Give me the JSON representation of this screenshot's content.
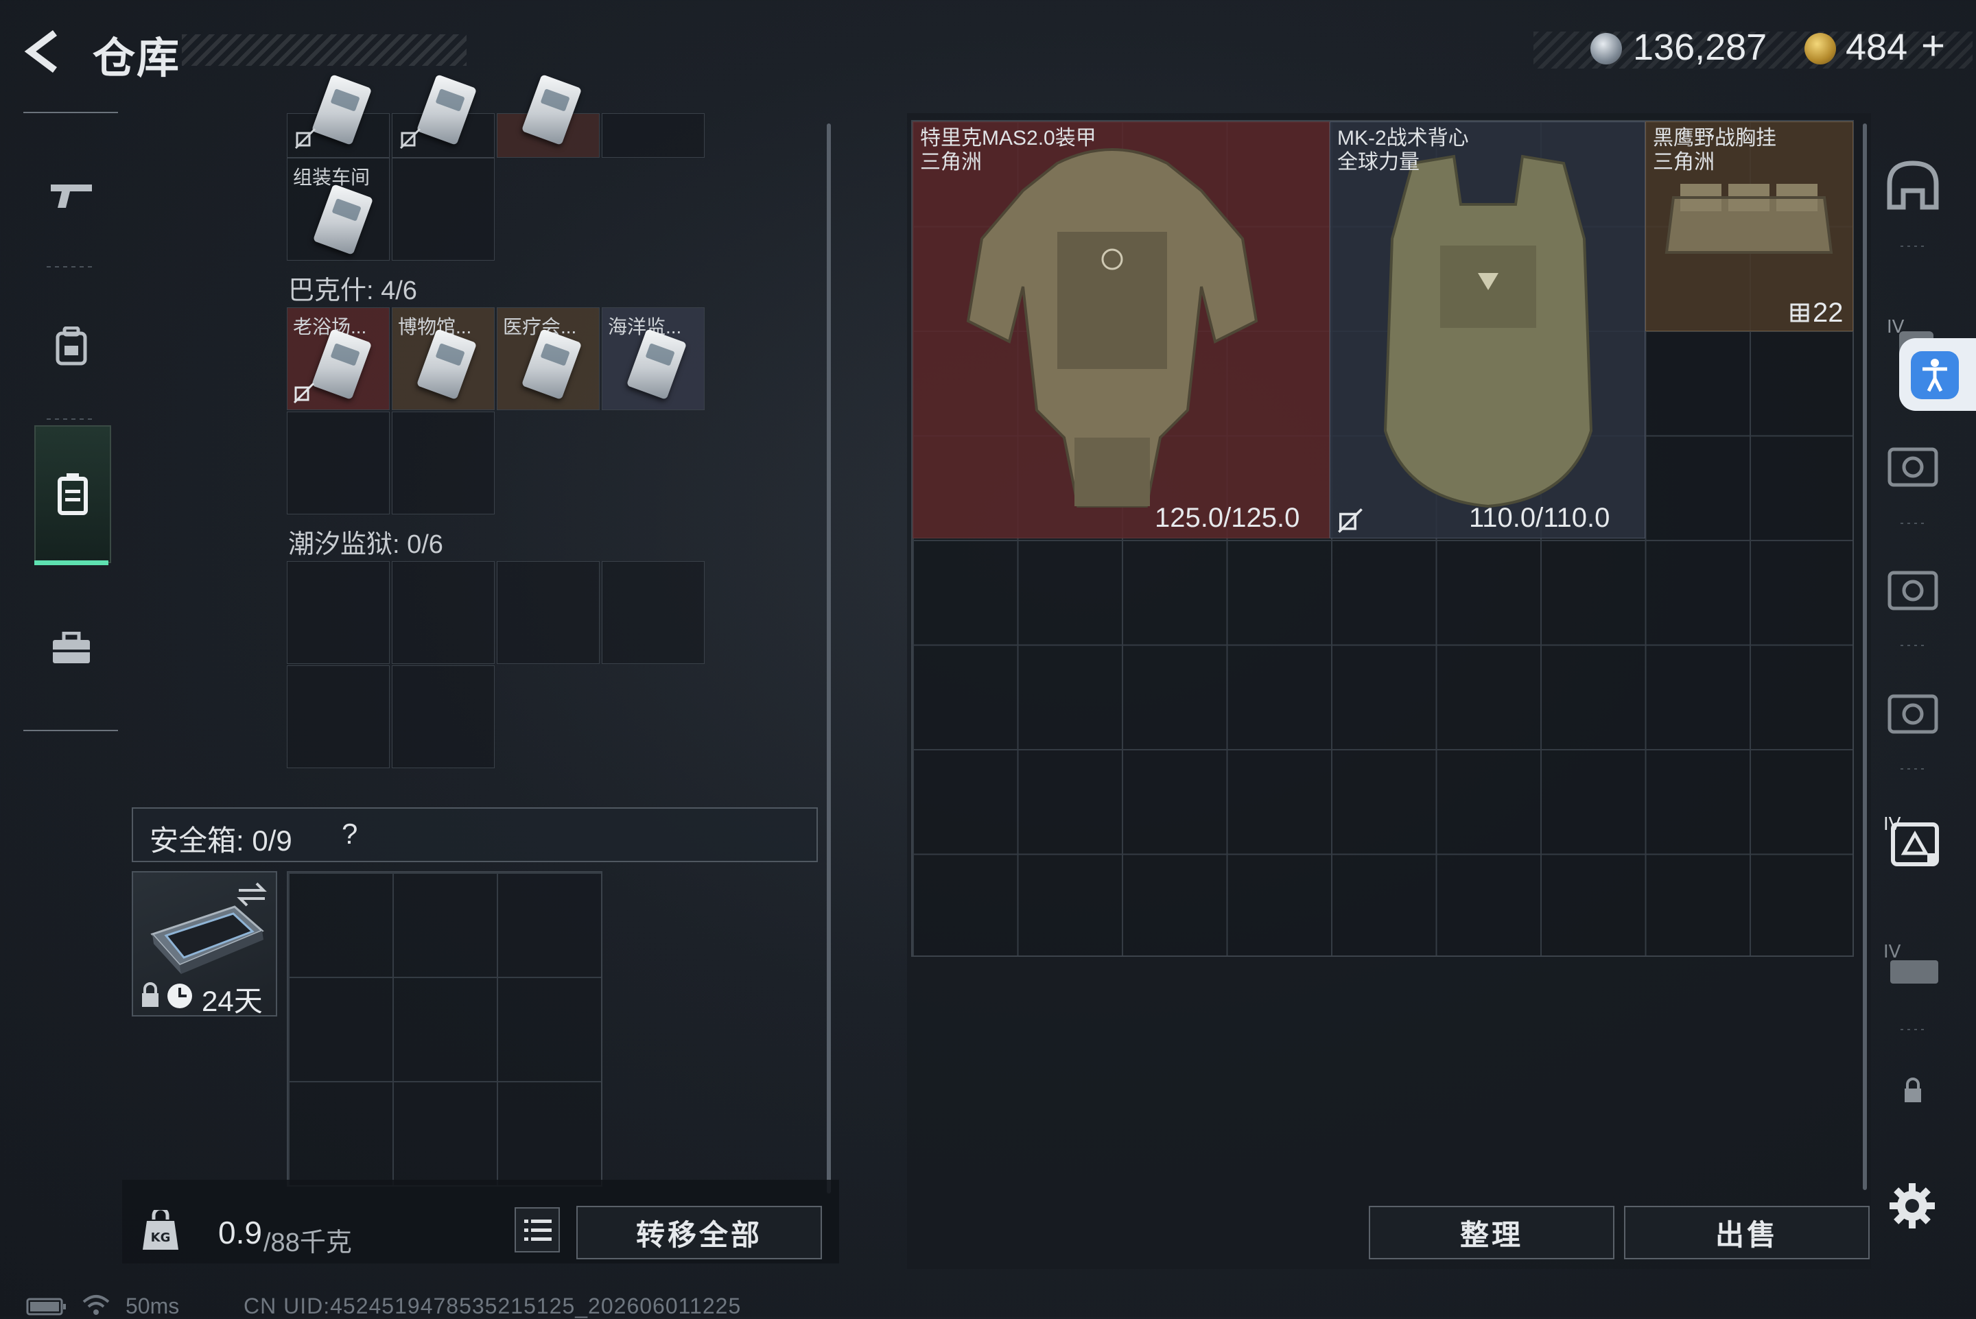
{
  "header": {
    "title": "仓库",
    "currency_silver": "136,287",
    "currency_gold": "484",
    "add_symbol": "+"
  },
  "left_nav": {
    "items": [
      "weapons-icon",
      "backpack-icon",
      "locker-icon",
      "toolbox-icon"
    ],
    "active_index": 2
  },
  "storage": {
    "top_partial_items": [
      "",
      "",
      ""
    ],
    "workshop_label": "组装车间",
    "bakesh_label": "巴克什: 4/6",
    "bakesh_keys": [
      "老浴场...",
      "博物馆...",
      "医疗会...",
      "海洋监..."
    ],
    "tidal_prison_label": "潮汐监狱: 0/6"
  },
  "safe_box": {
    "label": "安全箱: 0/9",
    "help": "?",
    "days_left": "24天"
  },
  "bottom_bar": {
    "weight_current": "0.9",
    "weight_capacity": "/88千克",
    "transfer_all": "转移全部"
  },
  "right_panel": {
    "items": [
      {
        "name": "特里克MAS2.0装甲",
        "origin": "三角洲",
        "durability": "125.0/125.0"
      },
      {
        "name": "MK-2战术背心",
        "origin": "全球力量",
        "durability": "110.0/110.0"
      },
      {
        "name": "黑鹰野战胸挂",
        "origin": "三角洲",
        "count": "22"
      }
    ],
    "sort_button": "整理",
    "sell_button": "出售"
  },
  "equipment_column": {
    "slots": [
      "helmet-slot-icon",
      "armor-slot-icon",
      "backpack-slot-icon",
      "chest-rig-slot-icon",
      "pouch-slot-icon",
      "case-slot-icon",
      "key-slot-icon",
      "lock-icon"
    ],
    "tier_label": "IV"
  },
  "status_bar": {
    "ping": "50ms",
    "uid": "CN UID:4524519478535215125_202606011225"
  },
  "colors": {
    "accent_green": "#5ee0b0",
    "red_rarity": "#5a2a2e",
    "gold_rarity": "#4a3a28",
    "accessibility_blue": "#3d88e6"
  }
}
